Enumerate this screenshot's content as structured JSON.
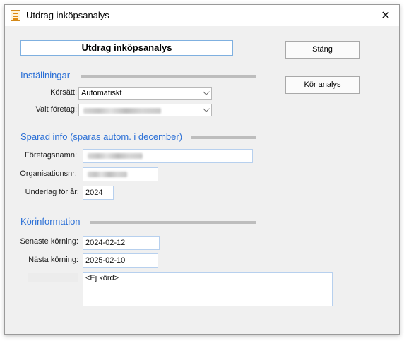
{
  "window": {
    "title": "Utdrag inköpsanalys",
    "close_icon": "close-icon",
    "app_icon": "spreadsheet-icon"
  },
  "header": {
    "heading": "Utdrag inköpsanalys"
  },
  "buttons": {
    "close_label": "Stäng",
    "run_label": "Kör analys"
  },
  "settings": {
    "section_title": "Inställningar",
    "mode_label": "Körsätt:",
    "mode_value": "Automatiskt",
    "company_label": "Valt företag:"
  },
  "saved_info": {
    "section_title": "Sparad info (sparas autom. i december)",
    "company_name_label": "Företagsnamn:",
    "org_number_label": "Organisationsnr:",
    "year_label": "Underlag för år:",
    "year_value": "2024"
  },
  "run_info": {
    "section_title": "Körinformation",
    "last_run_label": "Senaste körning:",
    "last_run_value": "2024-02-12",
    "next_run_label": "Nästa körning:",
    "next_run_value": "2025-02-10",
    "notes_value": "<Ej körd>"
  },
  "colors": {
    "accent": "#2a6fd6",
    "field_border": "#b7d0ee"
  }
}
